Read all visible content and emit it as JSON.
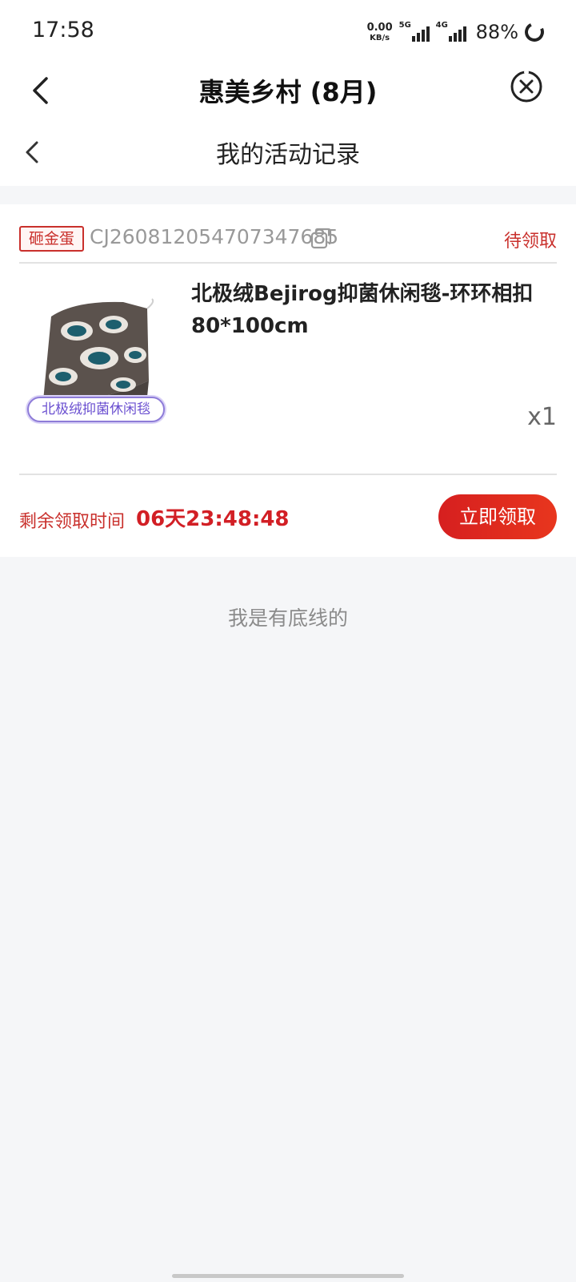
{
  "status_bar": {
    "time": "17:58",
    "net_speed_value": "0.00",
    "net_speed_unit": "KB/s",
    "signal1_label": "5G",
    "signal2_label": "4G",
    "battery": "88%"
  },
  "mini_program": {
    "title": "惠美乡村 (8月)",
    "back_icon": "chevron-left-icon",
    "close_icon": "close-circle-icon"
  },
  "page": {
    "title": "我的活动记录",
    "back_icon": "chevron-left-icon"
  },
  "record": {
    "tag": "砸金蛋",
    "order_no": "CJ260812054707347685",
    "copy_icon": "copy-icon",
    "status": "待领取",
    "product_badge": "北极绒抑菌休闲毯",
    "product_title": "北极绒Bejirog抑菌休闲毯-环环相扣80*100cm",
    "quantity": "x1",
    "remaining_label": "剩余领取时间",
    "remaining_value": "06天23:48:48",
    "claim_button": "立即领取"
  },
  "footer": {
    "end_text": "我是有底线的"
  },
  "colors": {
    "accent_red": "#d21f25",
    "background": "#f5f6f8"
  }
}
